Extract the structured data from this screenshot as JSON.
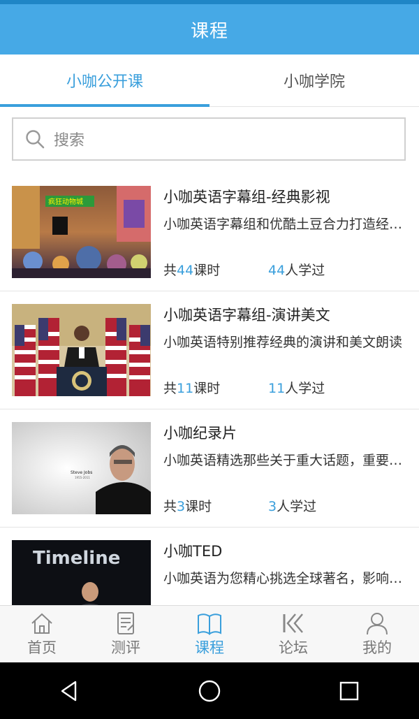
{
  "header": {
    "title": "课程"
  },
  "tabs": [
    {
      "label": "小咖公开课",
      "active": true
    },
    {
      "label": "小咖学院",
      "active": false
    }
  ],
  "search": {
    "placeholder": "搜索",
    "icon": "search-icon"
  },
  "courses": [
    {
      "title": "小咖英语字幕组-经典影视",
      "description": "小咖英语字幕组和优酷土豆合力打造经典影视",
      "lessons_prefix": "共",
      "lessons": "44",
      "lessons_suffix": "课时",
      "learners": "44",
      "learners_suffix": "人学过",
      "thumb_text": "疯狂动物城"
    },
    {
      "title": "小咖英语字幕组-演讲美文",
      "description": "小咖英语特别推荐经典的演讲和美文朗读",
      "lessons_prefix": "共",
      "lessons": "11",
      "lessons_suffix": "课时",
      "learners": "11",
      "learners_suffix": "人学过",
      "thumb_text": ""
    },
    {
      "title": "小咖纪录片",
      "description": "小咖英语精选那些关于重大话题，重要人物",
      "lessons_prefix": "共",
      "lessons": "3",
      "lessons_suffix": "课时",
      "learners": "3",
      "learners_suffix": "人学过",
      "thumb_text": "Steve Jobs",
      "thumb_subtext": "1955-2011"
    },
    {
      "title": "小咖TED",
      "description": "小咖英语为您精心挑选全球著名，影响力大的演讲",
      "lessons_prefix": "",
      "lessons": "",
      "lessons_suffix": "",
      "learners": "",
      "learners_suffix": "",
      "thumb_text": "Timeline"
    }
  ],
  "tabbar": [
    {
      "label": "首页",
      "icon": "home-icon"
    },
    {
      "label": "测评",
      "icon": "assessment-icon"
    },
    {
      "label": "课程",
      "icon": "book-icon",
      "active": true
    },
    {
      "label": "论坛",
      "icon": "forum-icon"
    },
    {
      "label": "我的",
      "icon": "profile-icon"
    }
  ],
  "colors": {
    "accent": "#3a9fdc",
    "header": "#46a9e6"
  }
}
